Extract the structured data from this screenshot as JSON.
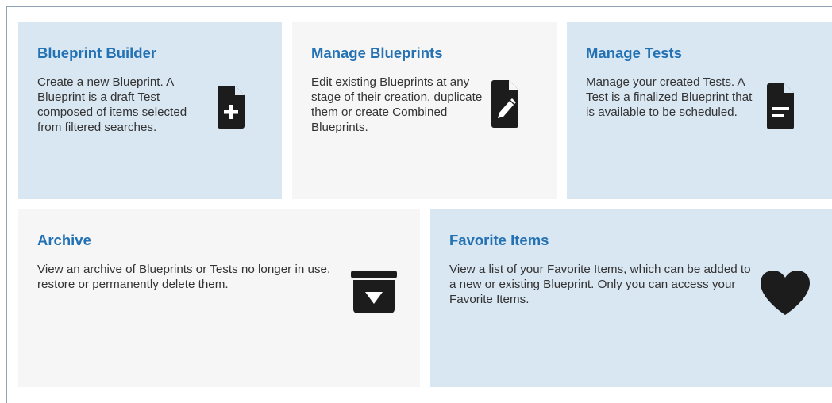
{
  "cards": [
    {
      "title": "Blueprint Builder",
      "description": "Create a new Blueprint. A Blueprint is a draft Test composed of items selected from filtered searches.",
      "icon": "file-plus-icon"
    },
    {
      "title": "Manage Blueprints",
      "description": "Edit existing Blueprints at any stage of their creation, duplicate them or create Combined Blueprints.",
      "icon": "file-edit-icon"
    },
    {
      "title": "Manage Tests",
      "description": "Manage your created Tests. A Test is a finalized Blueprint that is available to be scheduled.",
      "icon": "file-text-icon"
    },
    {
      "title": "Archive",
      "description": "View an archive of Blueprints or Tests no longer in use, restore or permanently delete them.",
      "icon": "archive-icon"
    },
    {
      "title": "Favorite Items",
      "description": "View a list of your Favorite Items, which can be added to a new or existing Blueprint. Only you can access your Favorite Items.",
      "icon": "heart-icon"
    }
  ],
  "colors": {
    "title": "#2472b4",
    "text": "#333333",
    "card_blue": "#d9e7f3",
    "card_gray": "#f6f6f6",
    "icon": "#1c1c1c"
  }
}
